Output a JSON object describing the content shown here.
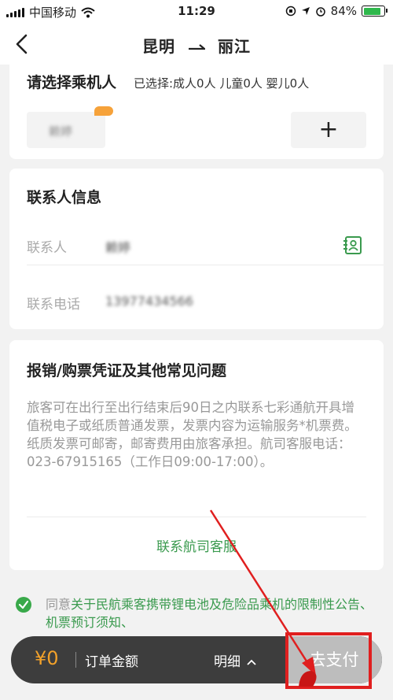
{
  "status_bar": {
    "carrier": "中国移动",
    "time": "11:29",
    "battery": "84%",
    "battery_level": 0.84
  },
  "nav": {
    "origin": "昆明",
    "destination": "丽江"
  },
  "passenger": {
    "title": "请选择乘机人",
    "selected_summary": "已选择:成人0人  儿童0人  婴儿0人",
    "chip_name": "赖婷",
    "add_label": "+"
  },
  "contact": {
    "title": "联系人信息",
    "name_label": "联系人",
    "name_value": "赖婷",
    "phone_label": "联系电话",
    "phone_value": "13977434566"
  },
  "faq": {
    "title": "报销/购票凭证及其他常见问题",
    "body": "旅客可在出行至出行结束后90日之内联系七彩通航开具增值税电子或纸质普通发票，发票内容为运输服务*机票费。纸质发票可邮寄，邮寄费用由旅客承担。航司客服电话：023-67915165（工作日09:00-17:00）。",
    "link": "联系航司客服"
  },
  "agreement": {
    "prefix": "同意",
    "links": "关于民航乘客携带锂电池及危险品乘机的限制性公告、机票预订须知、"
  },
  "pay_bar": {
    "currency": "¥",
    "amount": "0",
    "amount_label": "订单金额",
    "detail_label": "明细",
    "pay_label": "去支付"
  },
  "colors": {
    "accent_green": "#3a9a4e",
    "price_orange": "#f2a12a",
    "annotation_red": "#e01f1f"
  }
}
